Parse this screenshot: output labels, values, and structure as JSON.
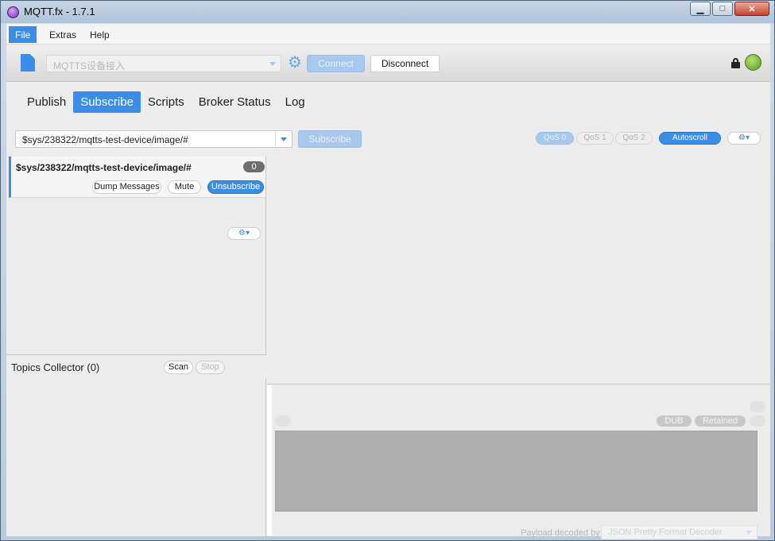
{
  "window": {
    "title": "MQTT.fx - 1.7.1",
    "controls": [
      "minimize",
      "maximize",
      "close"
    ]
  },
  "menu": {
    "items": [
      "File",
      "Extras",
      "Help"
    ],
    "active": "File"
  },
  "toolbar": {
    "profile_placeholder": "MQTTS设备接入",
    "connect_label": "Connect",
    "disconnect_label": "Disconnect",
    "status_color": "#6aa828",
    "accent_color": "#3b8ee8"
  },
  "tabs": {
    "items": [
      "Publish",
      "Subscribe",
      "Scripts",
      "Broker Status",
      "Log"
    ],
    "active": "Subscribe"
  },
  "subscribe_bar": {
    "topic_value": "$sys/238322/mqtts-test-device/image/#",
    "subscribe_label": "Subscribe",
    "qos": [
      "QoS 0",
      "QoS 1",
      "QoS 2"
    ],
    "qos_selected": "QoS 0",
    "autoscroll_label": "Autoscroll",
    "settings_icon": "gear-icon"
  },
  "subscriptions": [
    {
      "topic": "$sys/238322/mqtts-test-device/image/#",
      "count": "0",
      "dump_label": "Dump Messages",
      "mute_label": "Mute",
      "unsubscribe_label": "Unsubscribe"
    }
  ],
  "topics_collector": {
    "title": "Topics Collector (0)",
    "scan_label": "Scan",
    "stop_label": "Stop"
  },
  "message_detail": {
    "dub_label": "DUB",
    "retained_label": "Retained",
    "decoder_label": "Payload decoded by",
    "decoder_value": "JSON Pretty Format Decoder"
  }
}
